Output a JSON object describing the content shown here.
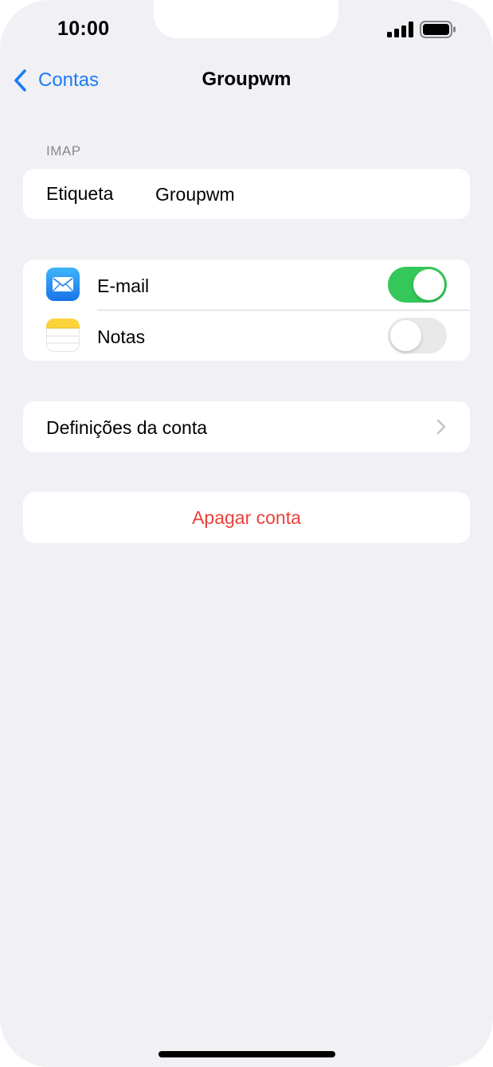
{
  "status_bar": {
    "time": "10:00",
    "signal_icon": "cellular-signal-icon",
    "battery_icon": "battery-icon"
  },
  "nav": {
    "back_label": "Contas",
    "back_icon": "chevron-left-icon",
    "title": "Groupwm"
  },
  "account_section": {
    "header": "IMAP",
    "label_field": {
      "label": "Etiqueta",
      "value": "Groupwm"
    }
  },
  "services": [
    {
      "label": "E-mail",
      "icon": "mail-app-icon",
      "enabled": true
    },
    {
      "label": "Notas",
      "icon": "notes-app-icon",
      "enabled": false
    }
  ],
  "account_settings": {
    "label": "Definições da conta",
    "chevron_icon": "chevron-right-icon"
  },
  "delete_account": {
    "label": "Apagar conta"
  },
  "colors": {
    "accent": "#1a7cf5",
    "toggle_on": "#34c759",
    "toggle_off": "#e9e9ea",
    "destructive": "#e8413a",
    "background": "#f0f0f5"
  }
}
